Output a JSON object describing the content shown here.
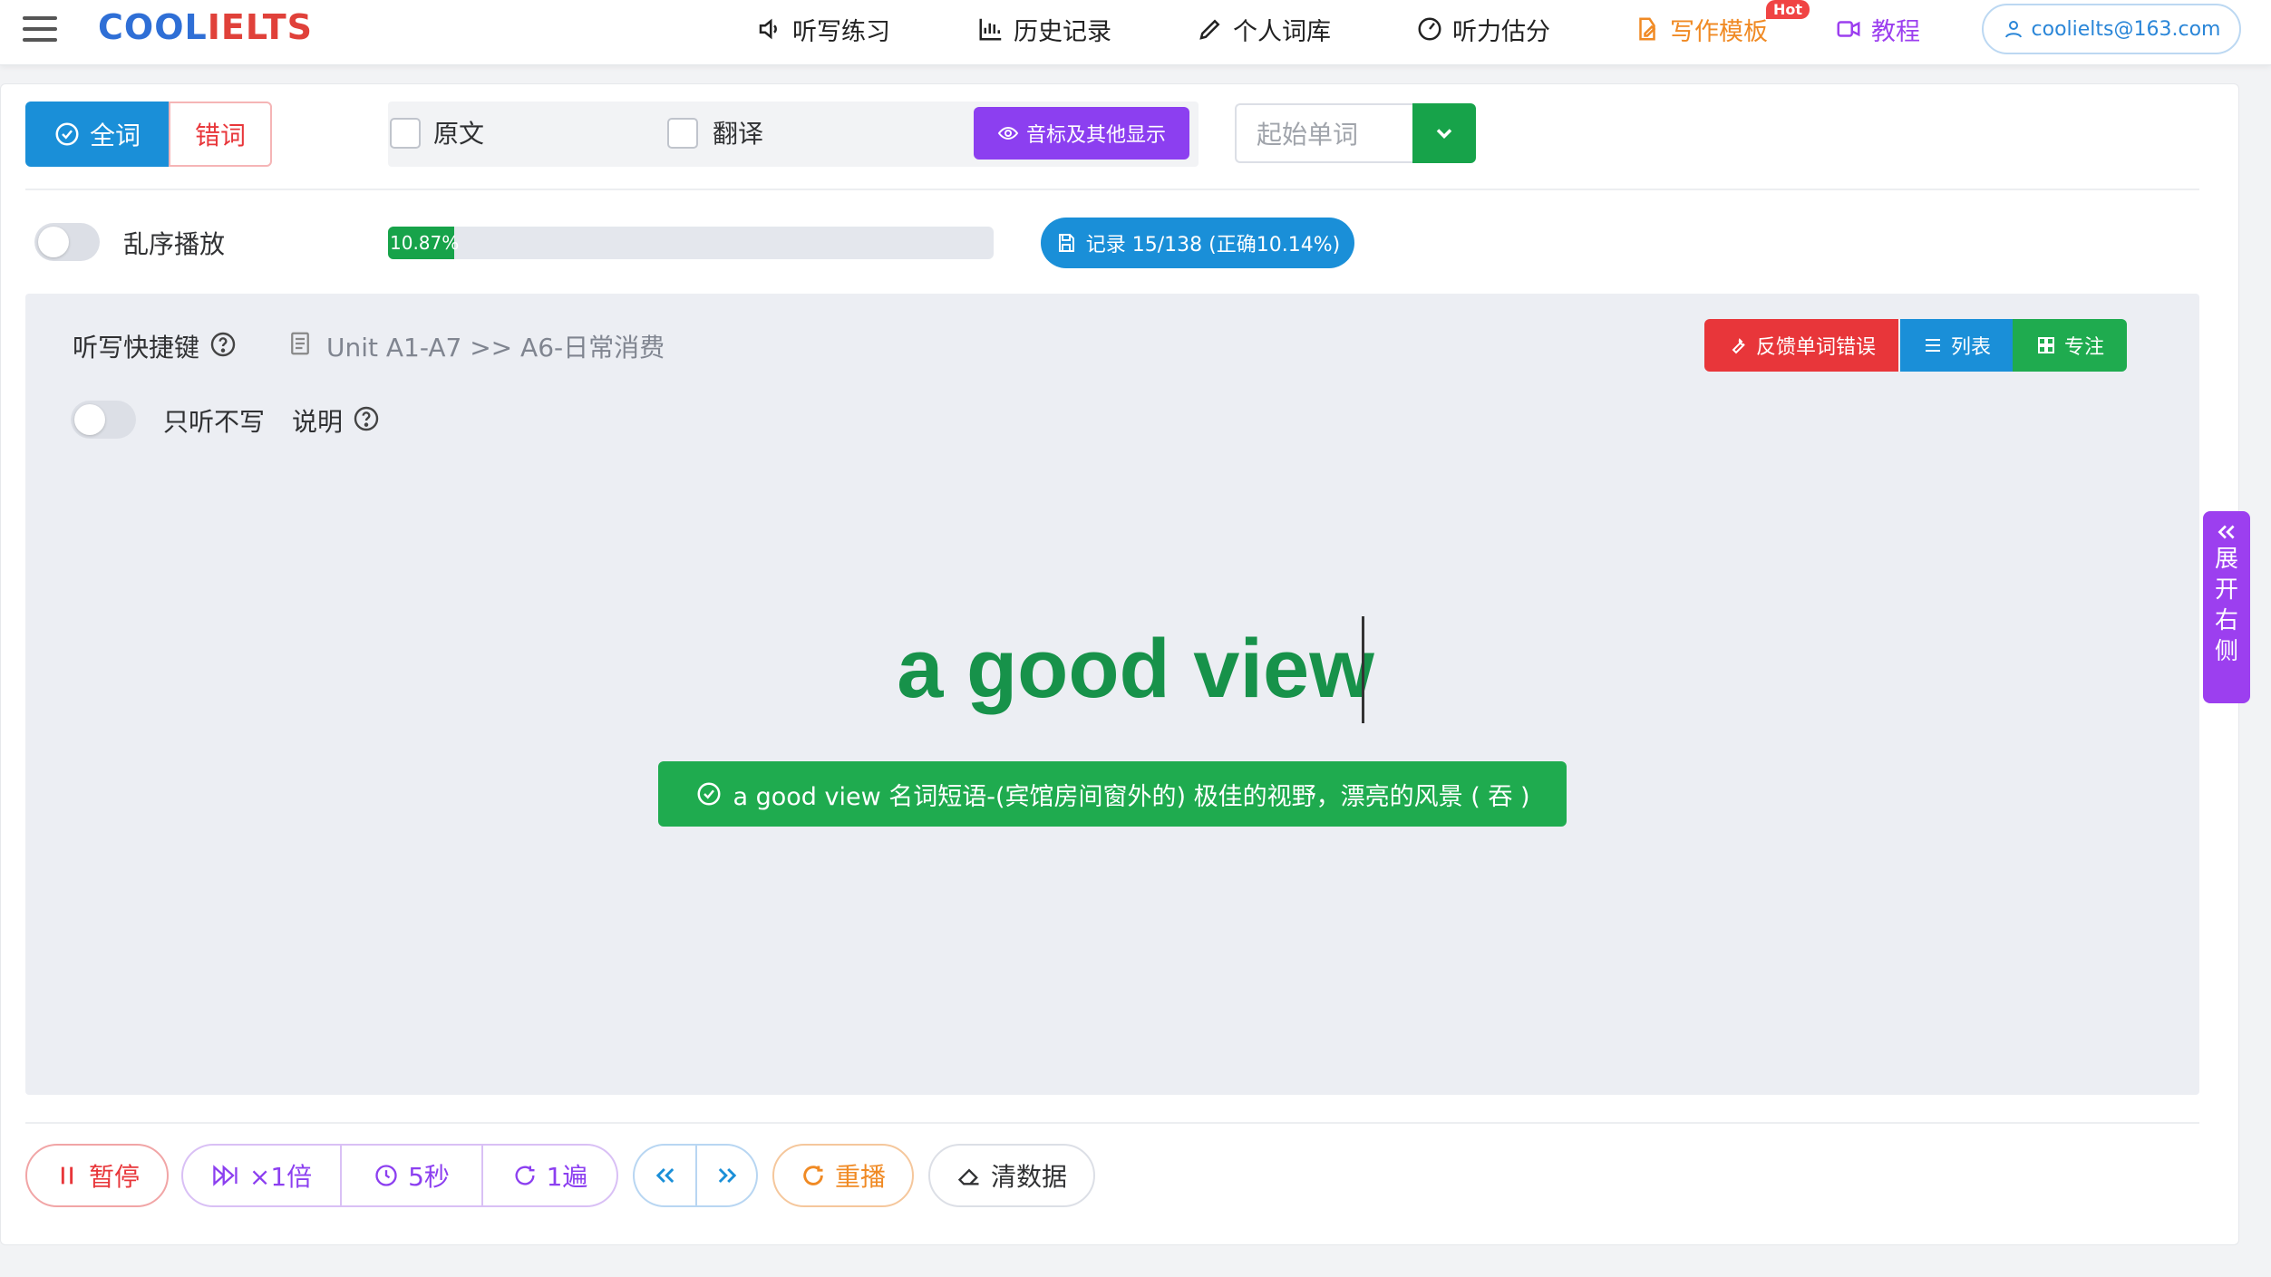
{
  "app": {
    "logo_part1": "COOL",
    "logo_part2": "IELTS"
  },
  "nav": {
    "items": [
      {
        "label": "听写练习",
        "icon": "speaker-icon"
      },
      {
        "label": "历史记录",
        "icon": "bar-chart-icon"
      },
      {
        "label": "个人词库",
        "icon": "pencil-icon"
      },
      {
        "label": "听力估分",
        "icon": "gauge-icon"
      },
      {
        "label": "写作模板",
        "icon": "edit-doc-icon",
        "badge": "Hot"
      },
      {
        "label": "教程",
        "icon": "video-icon"
      }
    ],
    "user_email": "coolielts@163.com"
  },
  "toolbar": {
    "mode_all": "全词",
    "mode_wrong": "错词",
    "show_original": "原文",
    "show_translation": "翻译",
    "phonetic_button": "音标及其他显示",
    "start_word_placeholder": "起始单词"
  },
  "status": {
    "shuffle_label": "乱序播放",
    "progress_text": "10.87%",
    "progress_value": 10.87,
    "record_button": "记录 15/138 (正确10.14%)"
  },
  "panel": {
    "shortcuts_label": "听写快捷键",
    "breadcrumb": "Unit A1-A7 >> A6-日常消费",
    "listen_only_label": "只听不写",
    "explain_label": "说明",
    "feedback_button": "反馈单词错误",
    "list_button": "列表",
    "focus_button": "专注",
    "current_word": "a good view",
    "definition": "a good view 名词短语-(宾馆房间窗外的) 极佳的视野，漂亮的风景 ( 吞 )"
  },
  "side_tab": {
    "chars": [
      "展",
      "开",
      "右",
      "侧"
    ]
  },
  "controls": {
    "pause": "暂停",
    "speed": "×1倍",
    "interval": "5秒",
    "repeat": "1遍",
    "replay": "重播",
    "clear": "清数据"
  },
  "colors": {
    "primary_blue": "#1a8fd8",
    "green": "#17a34a",
    "purple": "#8c3ff0",
    "red": "#e8363a",
    "orange": "#f08a24"
  }
}
